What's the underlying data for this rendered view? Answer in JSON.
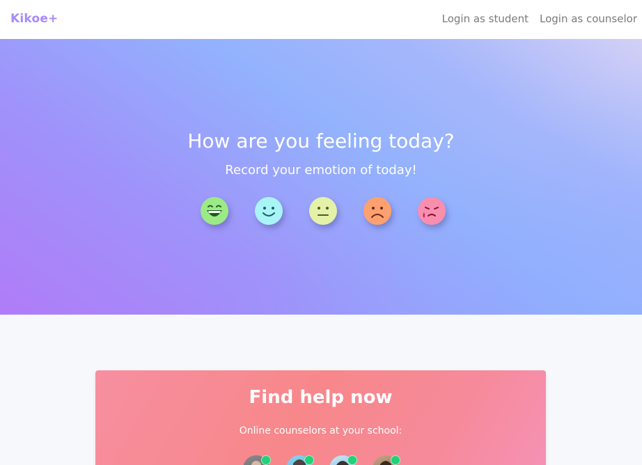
{
  "navbar": {
    "brand": "Kikoe+",
    "links": [
      {
        "label": "Login as student"
      },
      {
        "label": "Login as counselor"
      }
    ]
  },
  "hero": {
    "title": "How are you feeling today?",
    "subtitle": "Record your emotion of today!",
    "emotions": [
      {
        "icon": "grinning-face-icon",
        "color": "#9bea86"
      },
      {
        "icon": "smiling-face-icon",
        "color": "#a8f4f6"
      },
      {
        "icon": "neutral-face-icon",
        "color": "#e4f1a8"
      },
      {
        "icon": "frowning-face-icon",
        "color": "#ffa070"
      },
      {
        "icon": "crying-face-icon",
        "color": "#f98eae"
      }
    ]
  },
  "help": {
    "title": "Find help now",
    "subtitle": "Online counselors at your school:",
    "counselors": [
      {
        "status": "online",
        "status_color": "#22d17a"
      },
      {
        "status": "online",
        "status_color": "#22d17a"
      },
      {
        "status": "online",
        "status_color": "#22d17a"
      },
      {
        "status": "online",
        "status_color": "#22d17a"
      }
    ]
  }
}
